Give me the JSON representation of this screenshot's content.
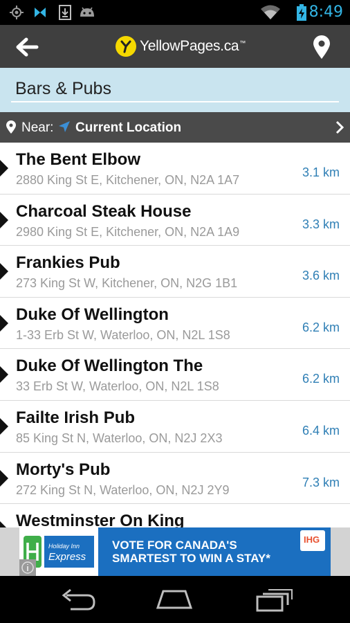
{
  "status_bar": {
    "time": "8:49",
    "icons": [
      "gps-icon",
      "bluetooth-icon",
      "download-icon",
      "android-icon",
      "wifi-icon",
      "battery-charging-icon"
    ]
  },
  "app_bar": {
    "logo_text": "YellowPages.ca",
    "logo_trademark": "™",
    "back_icon": "arrow-left-icon",
    "location_icon": "map-pin-icon"
  },
  "search": {
    "value": "Bars & Pubs"
  },
  "near": {
    "label": "Near:",
    "value": "Current Location"
  },
  "results": [
    {
      "name": "The Bent Elbow",
      "address": "2880 King St E, Kitchener, ON, N2A 1A7",
      "distance": "3.1 km"
    },
    {
      "name": "Charcoal Steak House",
      "address": "2980 King St E, Kitchener, ON, N2A 1A9",
      "distance": "3.3 km"
    },
    {
      "name": "Frankies Pub",
      "address": "273 King St W, Kitchener, ON, N2G 1B1",
      "distance": "3.6 km"
    },
    {
      "name": "Duke Of Wellington",
      "address": "1-33 Erb St W, Waterloo, ON, N2L 1S8",
      "distance": "6.2 km"
    },
    {
      "name": "Duke Of Wellington The",
      "address": "33 Erb St W, Waterloo, ON, N2L 1S8",
      "distance": "6.2 km"
    },
    {
      "name": "Failte Irish Pub",
      "address": "85 King St N, Waterloo, ON, N2J 2X3",
      "distance": "6.4 km"
    },
    {
      "name": "Morty's Pub",
      "address": "272 King St N, Waterloo, ON, N2J 2Y9",
      "distance": "7.3 km"
    },
    {
      "name": "Westminster On King",
      "address": "",
      "distance": ""
    }
  ],
  "ad": {
    "logo_line1": "Holiday Inn",
    "logo_line2": "Express",
    "headline": "VOTE FOR CANADA'S SMARTEST TO WIN A STAY*",
    "brand": "IHG"
  },
  "colors": {
    "status_accent": "#33b5e5",
    "brand_yellow": "#f5d800",
    "distance_blue": "#2f7fb5",
    "search_bg": "#c9e4ef"
  }
}
